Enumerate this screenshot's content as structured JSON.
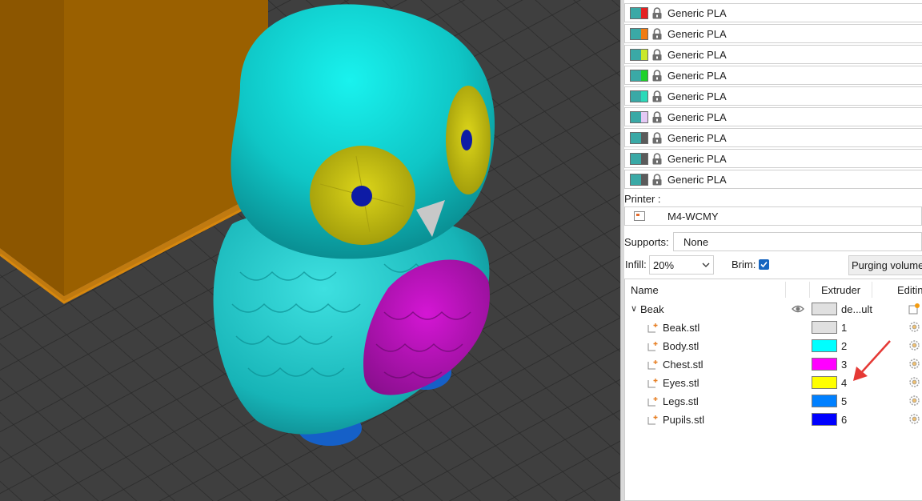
{
  "filaments": [
    {
      "name": "Generic PLA",
      "color": "#e52222"
    },
    {
      "name": "Generic PLA",
      "color": "#f07b12"
    },
    {
      "name": "Generic PLA",
      "color": "#c9e82b"
    },
    {
      "name": "Generic PLA",
      "color": "#1ed12a"
    },
    {
      "name": "Generic PLA",
      "color": "#2bd9b9"
    },
    {
      "name": "Generic PLA",
      "color": "#e4c9f5"
    },
    {
      "name": "Generic PLA",
      "color": "#5b5b5b"
    },
    {
      "name": "Generic PLA",
      "color": "#5b5b5b"
    },
    {
      "name": "Generic PLA",
      "color": "#5b5b5b"
    }
  ],
  "printer": {
    "label": "Printer :",
    "value": "M4-WCMY"
  },
  "supports": {
    "label": "Supports:",
    "value": "None"
  },
  "infill": {
    "label": "Infill:",
    "value": "20%"
  },
  "brim": {
    "label": "Brim:",
    "checked": true
  },
  "purging_button": "Purging volume",
  "object_list": {
    "columns": {
      "name": "Name",
      "extruder": "Extruder",
      "editing": "Editin"
    },
    "object": {
      "name": "Beak",
      "extruder": "de...ult",
      "color": "#e0e0e0"
    },
    "parts": [
      {
        "name": "Beak.stl",
        "extruder": "1",
        "color": "#e0e0e0"
      },
      {
        "name": "Body.stl",
        "extruder": "2",
        "color": "#00ffff"
      },
      {
        "name": "Chest.stl",
        "extruder": "3",
        "color": "#ff00ff"
      },
      {
        "name": "Eyes.stl",
        "extruder": "4",
        "color": "#ffff00"
      },
      {
        "name": "Legs.stl",
        "extruder": "5",
        "color": "#0080ff"
      },
      {
        "name": "Pupils.stl",
        "extruder": "6",
        "color": "#0000ff"
      }
    ]
  },
  "colors": {
    "swatch_base": "#3aa9a6",
    "accent_checkbox": "#1565c0",
    "annotation_arrow": "#e53935"
  }
}
